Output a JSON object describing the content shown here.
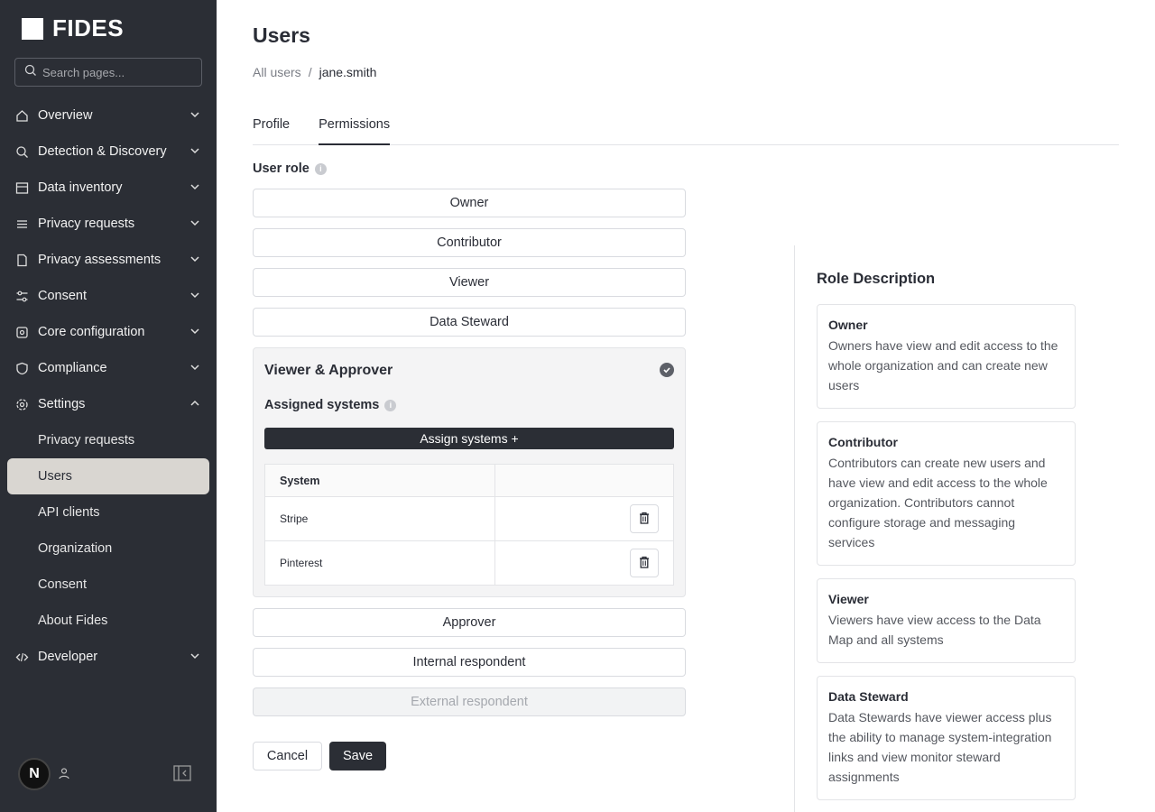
{
  "app": {
    "logo_text": "FIDES"
  },
  "search": {
    "placeholder": "Search pages..."
  },
  "nav": {
    "items": [
      {
        "label": "Overview",
        "icon": "home-icon"
      },
      {
        "label": "Detection & Discovery",
        "icon": "radar-icon"
      },
      {
        "label": "Data inventory",
        "icon": "table-icon"
      },
      {
        "label": "Privacy requests",
        "icon": "inbox-icon"
      },
      {
        "label": "Privacy assessments",
        "icon": "document-icon"
      },
      {
        "label": "Consent",
        "icon": "sliders-icon"
      },
      {
        "label": "Core configuration",
        "icon": "config-icon"
      },
      {
        "label": "Compliance",
        "icon": "shield-icon"
      },
      {
        "label": "Settings",
        "icon": "gear-icon"
      },
      {
        "label": "Developer",
        "icon": "code-icon"
      }
    ],
    "settings_sub": [
      "Privacy requests",
      "Users",
      "API clients",
      "Organization",
      "Consent",
      "About Fides"
    ]
  },
  "footer": {
    "avatar_letter": "N"
  },
  "page": {
    "title": "Users",
    "breadcrumb_root": "All users",
    "breadcrumb_sep": "/",
    "breadcrumb_current": "jane.smith",
    "tabs": [
      "Profile",
      "Permissions"
    ]
  },
  "roles": {
    "label": "User role",
    "buttons": [
      "Owner",
      "Contributor",
      "Viewer",
      "Data Steward"
    ],
    "selected": "Viewer & Approver",
    "assigned_label": "Assigned systems",
    "assign_button": "Assign systems +",
    "table_header": "System",
    "systems": [
      "Stripe",
      "Pinterest"
    ],
    "after_buttons": [
      "Approver",
      "Internal respondent",
      "External respondent"
    ]
  },
  "actions": {
    "cancel": "Cancel",
    "save": "Save"
  },
  "description": {
    "title": "Role Description",
    "cards": [
      {
        "name": "Owner",
        "text": "Owners have view and edit access to the whole organization and can create new users"
      },
      {
        "name": "Contributor",
        "text": "Contributors can create new users and have view and edit access to the whole organization. Contributors cannot configure storage and messaging services"
      },
      {
        "name": "Viewer",
        "text": "Viewers have view access to the Data Map and all systems"
      },
      {
        "name": "Data Steward",
        "text": "Data Stewards have viewer access plus the ability to manage system-integration links and view monitor steward assignments"
      }
    ]
  }
}
